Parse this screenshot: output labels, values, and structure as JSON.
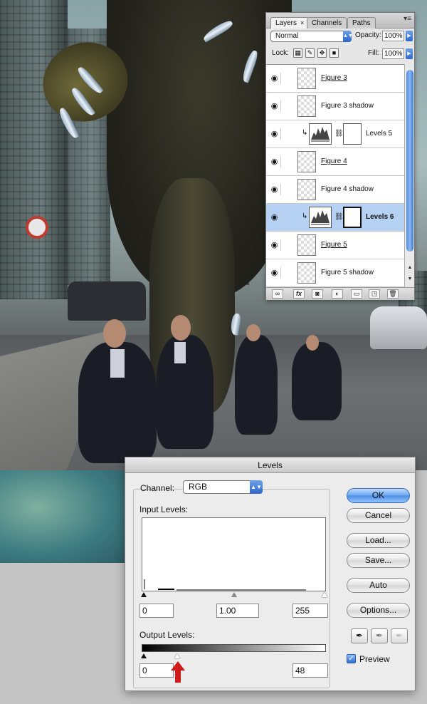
{
  "layers_panel": {
    "tabs": [
      "Layers",
      "Channels",
      "Paths"
    ],
    "close_glyph": "×",
    "blend_mode": "Normal",
    "opacity_label": "Opacity:",
    "opacity_value": "100%",
    "lock_label": "Lock:",
    "fill_label": "Fill:",
    "fill_value": "100%",
    "layers": [
      {
        "name": "Figure 3",
        "kind": "pixel",
        "underline": true,
        "selected": false
      },
      {
        "name": "Figure 3 shadow",
        "kind": "pixel",
        "underline": false,
        "selected": false
      },
      {
        "name": "Levels 5",
        "kind": "adjustment",
        "underline": false,
        "selected": false
      },
      {
        "name": "Figure 4",
        "kind": "pixel",
        "underline": true,
        "selected": false
      },
      {
        "name": "Figure 4 shadow",
        "kind": "pixel",
        "underline": false,
        "selected": false
      },
      {
        "name": "Levels 6",
        "kind": "adjustment",
        "underline": false,
        "selected": true
      },
      {
        "name": "Figure 5",
        "kind": "pixel",
        "underline": true,
        "selected": false
      },
      {
        "name": "Figure 5 shadow",
        "kind": "pixel",
        "underline": false,
        "selected": false
      }
    ],
    "bottom_icons": [
      "link-icon",
      "fx-icon",
      "mask-icon",
      "adjustment-icon",
      "folder-icon",
      "new-layer-icon",
      "trash-icon"
    ],
    "fx_label": "fx"
  },
  "levels_dialog": {
    "title": "Levels",
    "channel_label": "Channel:",
    "channel_value": "RGB",
    "input_levels_label": "Input Levels:",
    "input_black": "0",
    "input_gamma": "1.00",
    "input_white": "255",
    "output_levels_label": "Output Levels:",
    "output_black": "0",
    "output_white": "48",
    "buttons": {
      "ok": "OK",
      "cancel": "Cancel",
      "load": "Load...",
      "save": "Save...",
      "auto": "Auto",
      "options": "Options..."
    },
    "preview_label": "Preview",
    "preview_checked": true
  },
  "colors": {
    "accent_blue": "#4c8ee6",
    "selected_layer": "#b5d2f5",
    "annotation_red": "#d11a1a"
  }
}
